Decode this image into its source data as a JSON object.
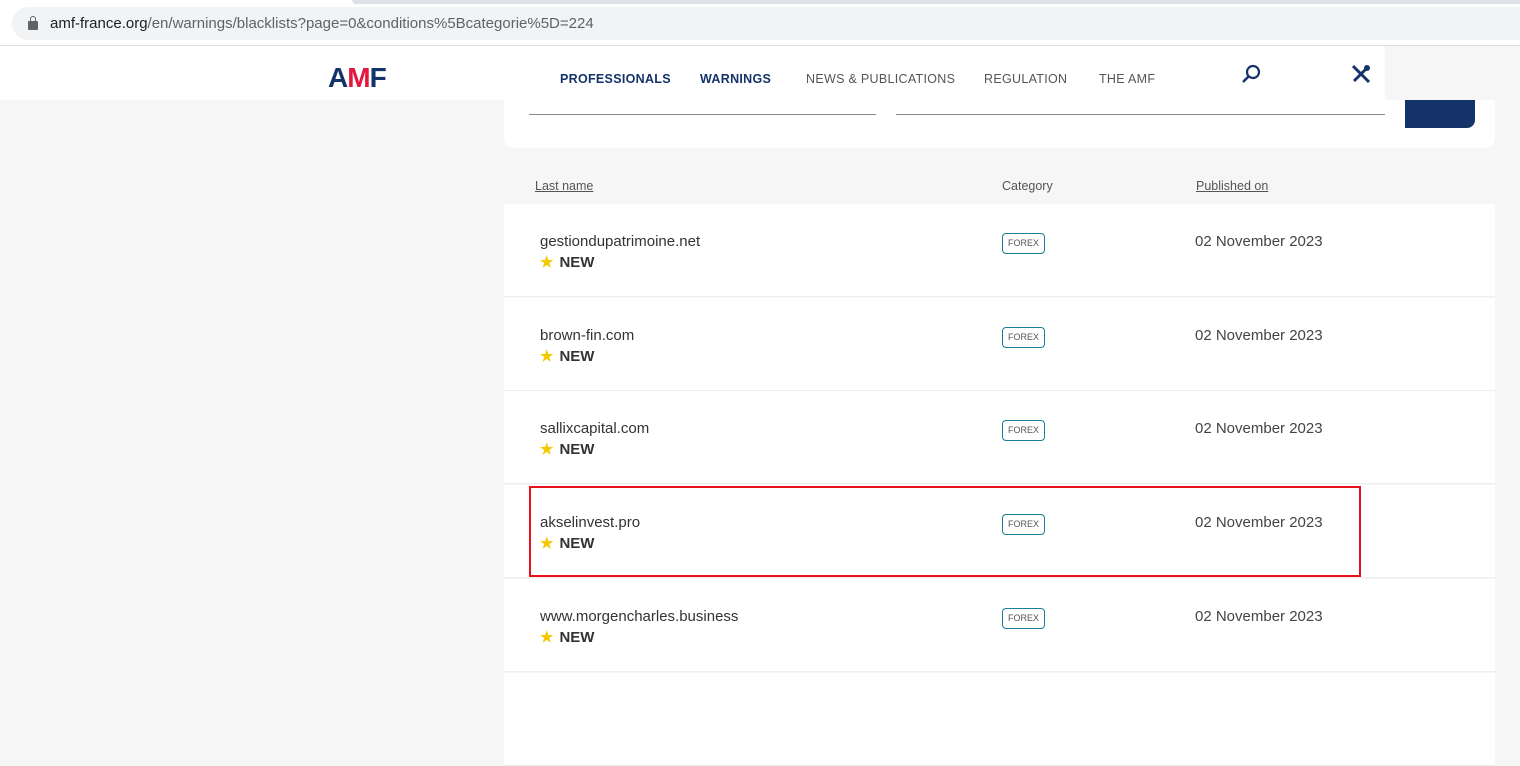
{
  "browser": {
    "url_host": "amf-france.org",
    "url_rest": "/en/warnings/blacklists?page=0&conditions%5Bcategorie%5D=224"
  },
  "header": {
    "logo": "AMF",
    "nav": [
      "PROFESSIONALS",
      "WARNINGS",
      "NEWS & PUBLICATIONS",
      "REGULATION",
      "THE AMF"
    ],
    "icons": [
      "search-icon",
      "tools-icon"
    ]
  },
  "table": {
    "headers": {
      "last_name": "Last name",
      "category": "Category",
      "published_on": "Published on"
    },
    "rows": [
      {
        "name": "gestiondupatrimoine.net",
        "new": "NEW",
        "category": "FOREX",
        "date": "02 November 2023"
      },
      {
        "name": "brown-fin.com",
        "new": "NEW",
        "category": "FOREX",
        "date": "02 November 2023"
      },
      {
        "name": "sallixcapital.com",
        "new": "NEW",
        "category": "FOREX",
        "date": "02 November 2023"
      },
      {
        "name": "akselinvest.pro",
        "new": "NEW",
        "category": "FOREX",
        "date": "02 November 2023"
      },
      {
        "name": "www.morgencharles.business",
        "new": "NEW",
        "category": "FOREX",
        "date": "02 November 2023"
      }
    ]
  },
  "colors": {
    "brand": "#14336a",
    "accent": "#e4173e",
    "highlight": "#e8121b",
    "star": "#f5c800"
  }
}
